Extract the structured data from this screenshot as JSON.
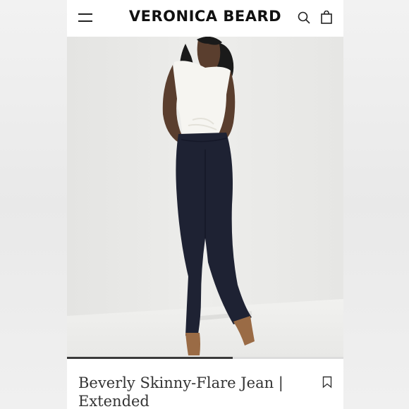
{
  "header": {
    "brand": "VERONICA BEARD",
    "menu_icon": "hamburger-menu-icon",
    "search_icon": "search-icon",
    "bag_icon": "shopping-bag-icon"
  },
  "gallery": {
    "image_alt": "Model wearing dark denim skinny-flare jeans with white top and tan boots",
    "progress": 0.6
  },
  "product": {
    "title": "Beverly Skinny-Flare Jean | Extended",
    "wishlist_icon": "bookmark-icon"
  },
  "colors": {
    "accent": "#111111",
    "denim": "#1e2233",
    "boot": "#9a6b45"
  }
}
